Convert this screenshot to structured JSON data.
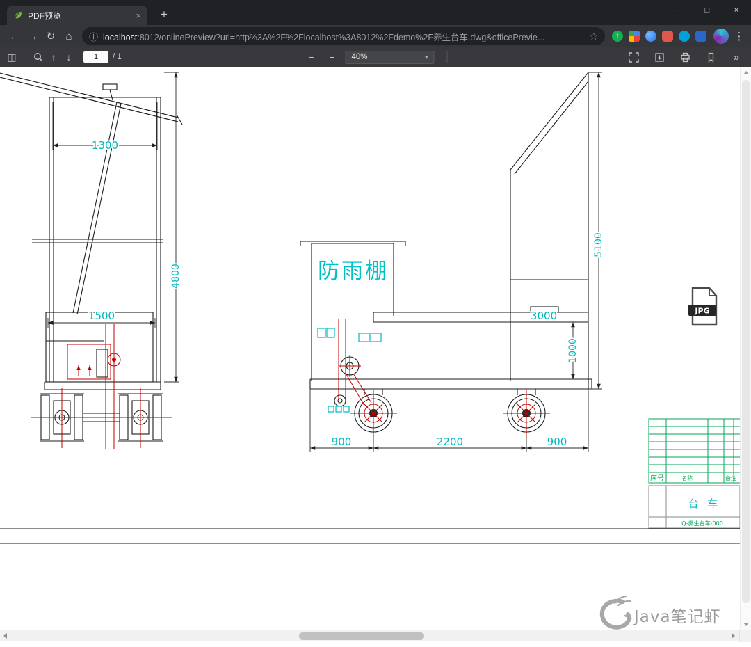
{
  "window": {
    "tab_title": "PDF预览",
    "tab_close": "×",
    "new_tab": "+",
    "minimize": "─",
    "maximize": "□",
    "close": "×"
  },
  "address": {
    "back": "←",
    "forward": "→",
    "reload": "↻",
    "home": "⌂",
    "info": "ⓘ",
    "host": "localhost",
    "path": ":8012/onlinePreview?url=http%3A%2F%2Flocalhost%3A8012%2Fdemo%2F养生台车.dwg&officePrevie...",
    "star": "☆",
    "ext_t": "t",
    "menu": "⋮"
  },
  "toolbar": {
    "sidebar_glyph": "◫",
    "page_up": "↑",
    "page_down": "↓",
    "page_value": "1",
    "page_total": "/ 1",
    "minus": "−",
    "plus": "+",
    "zoom_value": "40%",
    "caret": "▾",
    "more": "»"
  },
  "drawing": {
    "shelter_label": "防雨棚",
    "dims": {
      "width_top": "1300",
      "height_left": "4800",
      "width_inner": "1500",
      "height_right": "5100",
      "beam_length": "3000",
      "beam_height": "1000",
      "wheelbase_left": "900",
      "wheelbase_center": "2200",
      "wheelbase_right": "900"
    },
    "title_block": {
      "row_label": "序号",
      "col_name": "名称",
      "col_note": "备注",
      "part_name": "台 车",
      "doc_code": "Q-养生台车-000"
    },
    "jpg_badge": "JPG",
    "watermark": "Java笔记虾"
  },
  "colors": {
    "dimension_cyan": "#00b9bd",
    "cad_red": "#c00000",
    "table_green": "#00a651"
  }
}
